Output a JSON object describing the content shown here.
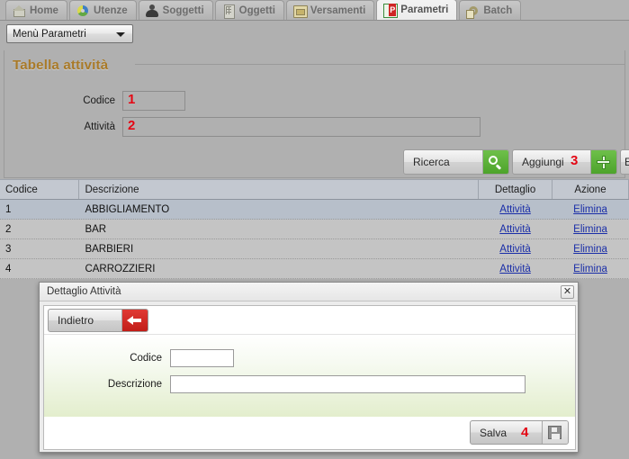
{
  "tabs": [
    {
      "label": "Home",
      "icon": "home-icon",
      "active": false
    },
    {
      "label": "Utenze",
      "icon": "users-icon",
      "active": false
    },
    {
      "label": "Soggetti",
      "icon": "person-icon",
      "active": false
    },
    {
      "label": "Oggetti",
      "icon": "building-icon",
      "active": false
    },
    {
      "label": "Versamenti",
      "icon": "payment-icon",
      "active": false
    },
    {
      "label": "Parametri",
      "icon": "parameters-icon",
      "active": true
    },
    {
      "label": "Batch",
      "icon": "gear-icon",
      "active": false
    }
  ],
  "menu": {
    "selected": "Menù Parametri",
    "caret_icon": "chevron-down-icon"
  },
  "panel": {
    "legend": "Tabella attività",
    "legend_color": "#a97a28",
    "fields": [
      {
        "label": "Codice",
        "value": "",
        "annotation": "1"
      },
      {
        "label": "Attività",
        "value": "",
        "annotation": "2"
      }
    ]
  },
  "actions": [
    {
      "label": "Ricerca",
      "icon": "search-icon",
      "icon_style": "green",
      "annotation": ""
    },
    {
      "label": "Aggiungi",
      "icon": "plus-icon",
      "icon_style": "green",
      "annotation": "3"
    },
    {
      "label": "E",
      "icon": "",
      "icon_style": "",
      "annotation": ""
    }
  ],
  "table": {
    "columns": [
      "Codice",
      "Descrizione",
      "Dettaglio",
      "Azione"
    ],
    "rows": [
      {
        "codice": "1",
        "descrizione": "ABBIGLIAMENTO",
        "dettaglio": "Attività",
        "azione": "Elimina",
        "selected": true
      },
      {
        "codice": "2",
        "descrizione": "BAR",
        "dettaglio": "Attività",
        "azione": "Elimina",
        "selected": false
      },
      {
        "codice": "3",
        "descrizione": "BARBIERI",
        "dettaglio": "Attività",
        "azione": "Elimina",
        "selected": false
      },
      {
        "codice": "4",
        "descrizione": "CARROZZIERI",
        "dettaglio": "Attività",
        "azione": "Elimina",
        "selected": false
      }
    ]
  },
  "modal": {
    "title": "Dettaglio Attività",
    "close_icon": "close-icon",
    "back_button": {
      "label": "Indietro",
      "icon": "back-arrow-icon"
    },
    "fields": [
      {
        "label": "Codice",
        "value": ""
      },
      {
        "label": "Descrizione",
        "value": ""
      }
    ],
    "save_button": {
      "label": "Salva",
      "icon": "save-floppy-icon",
      "annotation": "4"
    }
  },
  "colors": {
    "page_bg": "#b0b0b0",
    "accent_green": "#4da32b",
    "accent_red": "#c21d18",
    "annotation_red": "#e30613",
    "link_blue": "#1a2ea8",
    "legend_brown": "#a97a28"
  }
}
